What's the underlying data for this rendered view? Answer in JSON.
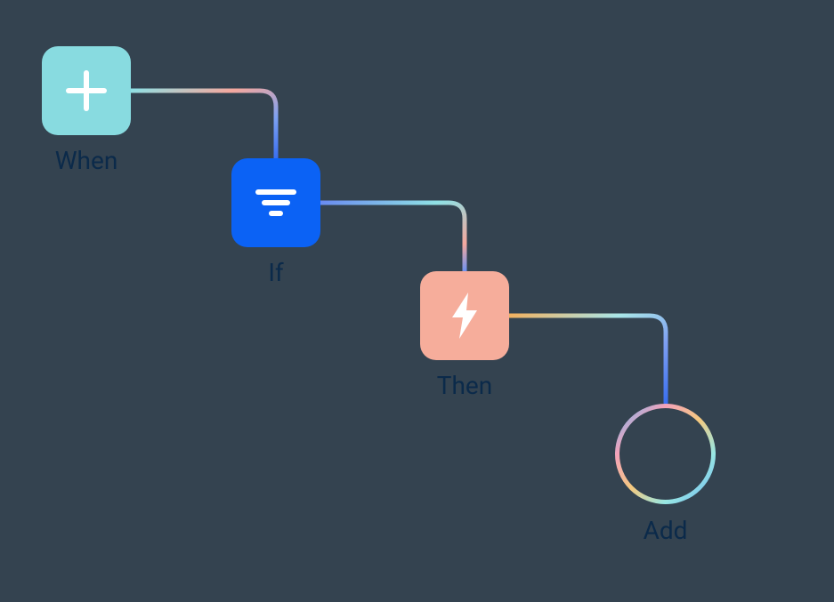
{
  "nodes": {
    "when": {
      "label": "When",
      "icon": "plus-icon",
      "color": "#88dbe0"
    },
    "if": {
      "label": "If",
      "icon": "filter-icon",
      "color": "#0b62f5"
    },
    "then": {
      "label": "Then",
      "icon": "lightning-icon",
      "color": "#f6ad9b"
    },
    "add": {
      "label": "Add",
      "icon": "plus-icon"
    }
  }
}
